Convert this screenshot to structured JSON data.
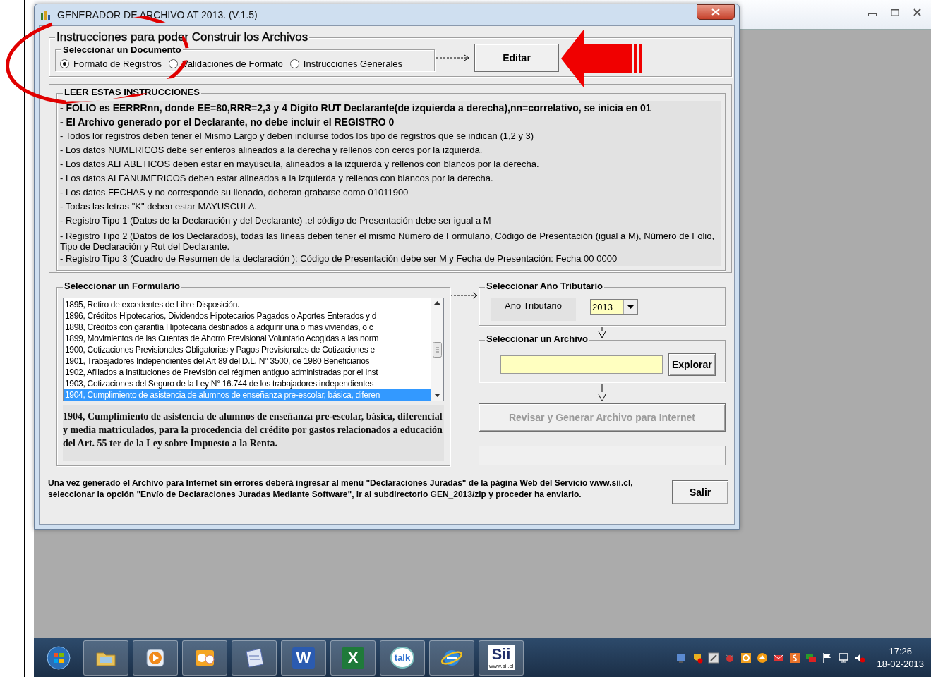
{
  "window": {
    "title": "GENERADOR DE ARCHIVO AT 2013. (V.1.5)"
  },
  "instructions": {
    "title": "Instrucciones para poder Construir los Archivos",
    "document_group": {
      "title": "Seleccionar un Documento",
      "options": [
        {
          "label": "Formato de Registros",
          "selected": true
        },
        {
          "label": "Validaciones de Formato",
          "selected": false
        },
        {
          "label": "Instrucciones Generales",
          "selected": false
        }
      ]
    },
    "edit_button": "Editar"
  },
  "read_panel": {
    "title": "LEER ESTAS INSTRUCCIONES",
    "lines": [
      {
        "kind": "bold",
        "text": "- FOLIO es EERRRnn, donde EE=80,RRR=2,3 y 4 Dígito RUT Declarante(de izquierda a derecha),nn=correlativo, se inicia en 01"
      },
      {
        "kind": "bold",
        "text": "- El Archivo generado por el Declarante, no debe incluir el REGISTRO 0"
      },
      {
        "kind": "normal",
        "text": "- Todos lor registros deben tener el Mismo Largo y deben incluirse todos los tipo de registros que se indican (1,2 y 3)"
      },
      {
        "kind": "normal",
        "text": "- Los datos NUMERICOS  debe ser enteros alineados a la derecha y rellenos con ceros por la izquierda."
      },
      {
        "kind": "normal",
        "text": "- Los datos ALFABETICOS deben estar en mayúscula, alineados a la izquierda y rellenos con blancos por la derecha."
      },
      {
        "kind": "normal",
        "text": "- Los datos ALFANUMERICOS deben estar alineados a la izquierda y rellenos con blancos por la derecha."
      },
      {
        "kind": "normal",
        "text": "- Los datos FECHAS y no corresponde su llenado, deberan grabarse como  01011900"
      },
      {
        "kind": "normal",
        "text": "- Todas las letras \"K\" deben estar MAYUSCULA."
      },
      {
        "kind": "normal",
        "text": "- Registro Tipo 1 (Datos de la Declaración y del Declarante) ,el código de Presentación debe ser igual a M"
      },
      {
        "kind": "tight",
        "text": "- Registro Tipo 2 (Datos de los Declarados), todas las líneas deben tener el mismo Número de Formulario, Código de Presentación (igual a M), Número de Folio, Tipo de Declaración y Rut del Declarante."
      },
      {
        "kind": "normal",
        "text": "- Registro Tipo 3 (Cuadro de Resumen de la declaración ): Código de Presentación debe ser M y Fecha de Presentación: Fecha 00   0000"
      }
    ]
  },
  "form_panel": {
    "title": "Seleccionar un Formulario",
    "items": [
      {
        "label": "1895, Retiro de excedentes de Libre Disposición.",
        "selected": false
      },
      {
        "label": "1896, Créditos Hipotecarios, Dividendos Hipotecarios Pagados o Aportes Enterados y d",
        "selected": false
      },
      {
        "label": "1898, Créditos con garantía Hipotecaria destinados a adquirir una o más viviendas, o c",
        "selected": false
      },
      {
        "label": "1899, Movimientos de las Cuentas de Ahorro Previsional Voluntario Acogidas a las norm",
        "selected": false
      },
      {
        "label": "1900, Cotizaciones Previsionales Obligatorias y  Pagos Previsionales de Cotizaciones e",
        "selected": false
      },
      {
        "label": "1901, Trabajadores Independientes del Art 89 del D.L. N° 3500, de 1980 Beneficiarios",
        "selected": false
      },
      {
        "label": "1902, Afiliados a Instituciones de Previsión del régimen antiguo administradas por el Inst",
        "selected": false
      },
      {
        "label": "1903, Cotizaciones del Seguro de la Ley N° 16.744 de los trabajadores independientes",
        "selected": false
      },
      {
        "label": "1904, Cumplimiento de asistencia de alumnos de enseñanza pre-escolar, básica, diferen",
        "selected": true
      }
    ],
    "description": "1904, Cumplimiento de asistencia de alumnos de enseñanza pre-escolar, básica, diferencial y media matriculados, para la procedencia del crédito por gastos relacionados a educación del Art. 55 ter de la Ley sobre Impuesto a la Renta."
  },
  "year_panel": {
    "title": "Seleccionar Año Tributario",
    "label": "Año Tributario",
    "value": "2013"
  },
  "file_panel": {
    "title": "Seleccionar un Archivo",
    "button": "Explorar"
  },
  "generate_button": {
    "label": "Revisar y Generar Archivo para Internet",
    "disabled": true
  },
  "footer_note": "Una vez generado el Archivo para Internet sin errores deberá ingresar al menú \"Declaraciones Juradas\" de  la página Web del Servicio www.sii.cl, seleccionar la opción \"Envío de Declaraciones Juradas Mediante Software\", ir al subdirectorio GEN_2013/zip y proceder ha enviarlo.",
  "exit_button": "Salir",
  "taskbar": {
    "apps": [
      {
        "kind": "folder"
      },
      {
        "kind": "media"
      },
      {
        "kind": "outlook"
      },
      {
        "kind": "document"
      },
      {
        "kind": "word",
        "label": "W"
      },
      {
        "kind": "excel",
        "label": "X"
      },
      {
        "kind": "talk",
        "label": "talk"
      },
      {
        "kind": "browser"
      },
      {
        "kind": "sii",
        "label": "Sii",
        "sub": "www.sii.cl"
      }
    ],
    "clock": {
      "time": "17:26",
      "date": "18-02-2013"
    }
  }
}
